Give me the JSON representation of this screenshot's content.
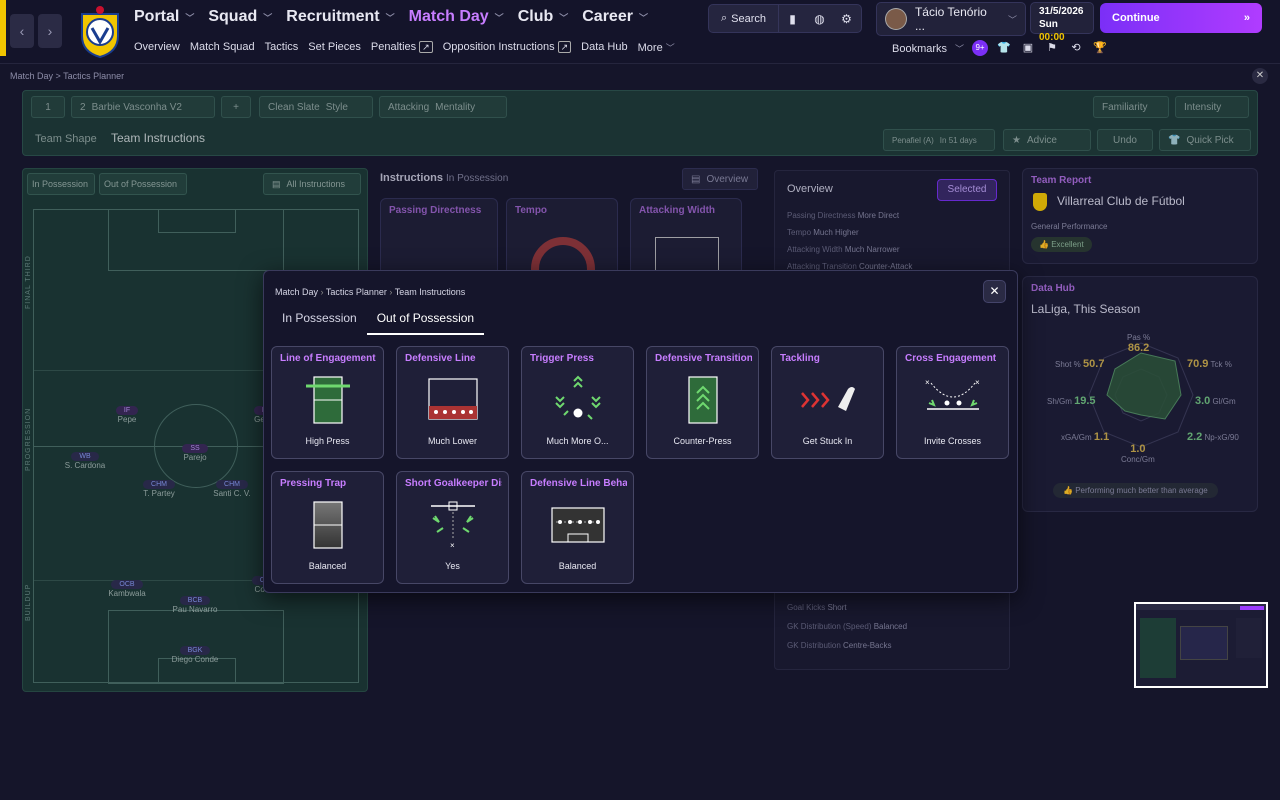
{
  "nav": {
    "main": [
      {
        "label": "Portal"
      },
      {
        "label": "Squad"
      },
      {
        "label": "Recruitment"
      },
      {
        "label": "Match Day"
      },
      {
        "label": "Club"
      },
      {
        "label": "Career"
      }
    ],
    "sub": [
      "Overview",
      "Match Squad",
      "Tactics",
      "Set Pieces",
      "Penalties",
      "Opposition Instructions",
      "Data Hub",
      "More"
    ]
  },
  "search": {
    "label": "Search"
  },
  "profile": {
    "name": "Tácio Tenório ..."
  },
  "date": {
    "date": "31/5/2026",
    "day": "Sun",
    "time": "00:00"
  },
  "continue_label": "Continue",
  "bookmarks_label": "Bookmarks",
  "bookmark_badge": "9+",
  "breadcrumb": {
    "a": "Match Day",
    "b": "Tactics Planner"
  },
  "tactics": {
    "slot": "1",
    "tactic_num": "2",
    "tactic_name": "Barbie Vasconha V2",
    "style_value": "Clean Slate",
    "style_label": "Style",
    "mentality_value": "Attacking",
    "mentality_label": "Mentality",
    "familiarity": "Familiarity",
    "intensity": "Intensity",
    "tab_shape": "Team Shape",
    "tab_instructions": "Team Instructions",
    "next_match": "Penafiel (A)",
    "next_when": "In 51 days",
    "advice": "Advice",
    "undo": "Undo",
    "quick_pick": "Quick Pick"
  },
  "pitch": {
    "tab_in": "In Possession",
    "tab_out": "Out of Possession",
    "all": "All Instructions",
    "zones": [
      "FINAL THIRD",
      "PROGRESSION",
      "BUILDUP"
    ],
    "players": [
      {
        "pos": "IF",
        "name": "Pepe",
        "purple": true
      },
      {
        "pos": "IF",
        "name": "Gen...",
        "purple": true
      },
      {
        "pos": "WB",
        "name": "S. Cardona",
        "purple": false
      },
      {
        "pos": "SS",
        "name": "Parejo",
        "purple": true
      },
      {
        "pos": "CHM",
        "name": "T. Partey",
        "purple": false
      },
      {
        "pos": "CHM",
        "name": "Santi C. V.",
        "purple": false
      },
      {
        "pos": "OCB",
        "name": "Kambwala",
        "purple": false
      },
      {
        "pos": "OC",
        "name": "Costa",
        "purple": false
      },
      {
        "pos": "BCB",
        "name": "Pau Navarro",
        "purple": false
      },
      {
        "pos": "BGK",
        "name": "Diego Conde",
        "purple": false
      }
    ]
  },
  "instructions": {
    "title": "Instructions",
    "sub": "In Possession",
    "overview_btn": "Overview",
    "cards": [
      "Passing Directness",
      "Tempo",
      "Attacking Width"
    ]
  },
  "overview": {
    "title": "Overview",
    "selected": "Selected",
    "rows": [
      {
        "k": "Passing Directness",
        "v": "More Direct"
      },
      {
        "k": "Tempo",
        "v": "Much Higher"
      },
      {
        "k": "Attacking Width",
        "v": "Much Narrower"
      },
      {
        "k": "Attacking Transition",
        "v": "Counter-Attack"
      }
    ],
    "rows_bottom": [
      {
        "k": "Goal Kicks",
        "v": "Short"
      },
      {
        "k": "GK Distribution (Speed)",
        "v": "Balanced"
      },
      {
        "k": "GK Distribution",
        "v": "Centre-Backs"
      }
    ]
  },
  "team_report": {
    "title": "Team Report",
    "club": "Villarreal Club de Fútbol",
    "perf_label": "General Performance",
    "perf": "Excellent"
  },
  "data_hub": {
    "title": "Data Hub",
    "sub": "LaLiga, This Season",
    "stats": [
      {
        "label": "Pas %",
        "value": "86.2"
      },
      {
        "label": "Tck %",
        "value": "70.9"
      },
      {
        "label": "Gl/Gm",
        "value": "3.0"
      },
      {
        "label": "Np-xG/90",
        "value": "2.2"
      },
      {
        "label": "Conc/Gm",
        "value": "1.0"
      },
      {
        "label": "xGA/Gm",
        "value": "1.1"
      },
      {
        "label": "Sh/Gm",
        "value": "19.5"
      },
      {
        "label": "Shot %",
        "value": "50.7"
      }
    ],
    "footer": "Performing much better than average"
  },
  "modal": {
    "crumb": [
      "Match Day",
      "Tactics Planner",
      "Team Instructions"
    ],
    "tab_in": "In Possession",
    "tab_out": "Out of Possession",
    "cards": [
      {
        "title": "Line of Engagement",
        "value": "High Press",
        "icon": "line-of-engagement-icon"
      },
      {
        "title": "Defensive Line",
        "value": "Much Lower",
        "icon": "defensive-line-icon"
      },
      {
        "title": "Trigger Press",
        "value": "Much More O...",
        "icon": "trigger-press-icon"
      },
      {
        "title": "Defensive Transition",
        "value": "Counter-Press",
        "icon": "defensive-transition-icon"
      },
      {
        "title": "Tackling",
        "value": "Get Stuck In",
        "icon": "tackling-icon"
      },
      {
        "title": "Cross Engagement",
        "value": "Invite Crosses",
        "icon": "cross-engagement-icon"
      },
      {
        "title": "Pressing Trap",
        "value": "Balanced",
        "icon": "pressing-trap-icon"
      },
      {
        "title": "Short Goalkeeper Distr",
        "value": "Yes",
        "icon": "goalkeeper-distribution-icon"
      },
      {
        "title": "Defensive Line Behavic",
        "value": "Balanced",
        "icon": "defensive-line-behaviour-icon"
      }
    ]
  }
}
